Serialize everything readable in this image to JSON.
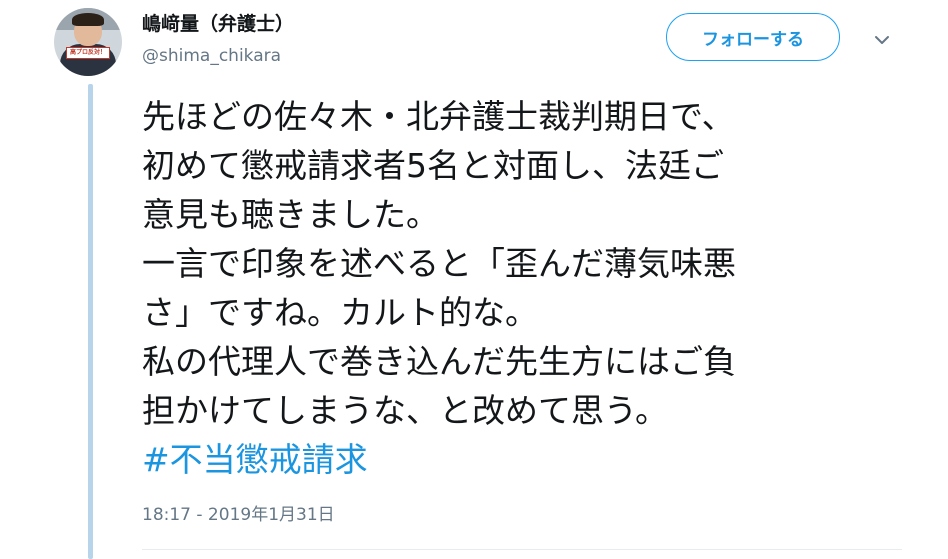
{
  "user": {
    "display_name": "嶋﨑量（弁護士）",
    "handle": "@shima_chikara",
    "avatar_sign": "高プロ反対！"
  },
  "actions": {
    "follow_label": "フォローする",
    "more_icon": "chevron-down-icon"
  },
  "tweet": {
    "lines": [
      "先ほどの佐々木・北弁護士裁判期日で、",
      "初めて懲戒請求者5名と対面し、法廷ご",
      "意見も聴きました。",
      "一言で印象を述べると「歪んだ薄気味悪",
      "さ」ですね。カルト的な。",
      "私の代理人で巻き込んだ先生方にはご負",
      "担かけてしまうな、と改めて思う。"
    ],
    "hashtag": "#不当懲戒請求",
    "timestamp": "18:17 - 2019年1月31日"
  },
  "colors": {
    "accent": "#1da1f2",
    "link": "#1b95e0",
    "text": "#14171a",
    "secondary": "#657786",
    "thread_line": "#b8d4ea"
  }
}
